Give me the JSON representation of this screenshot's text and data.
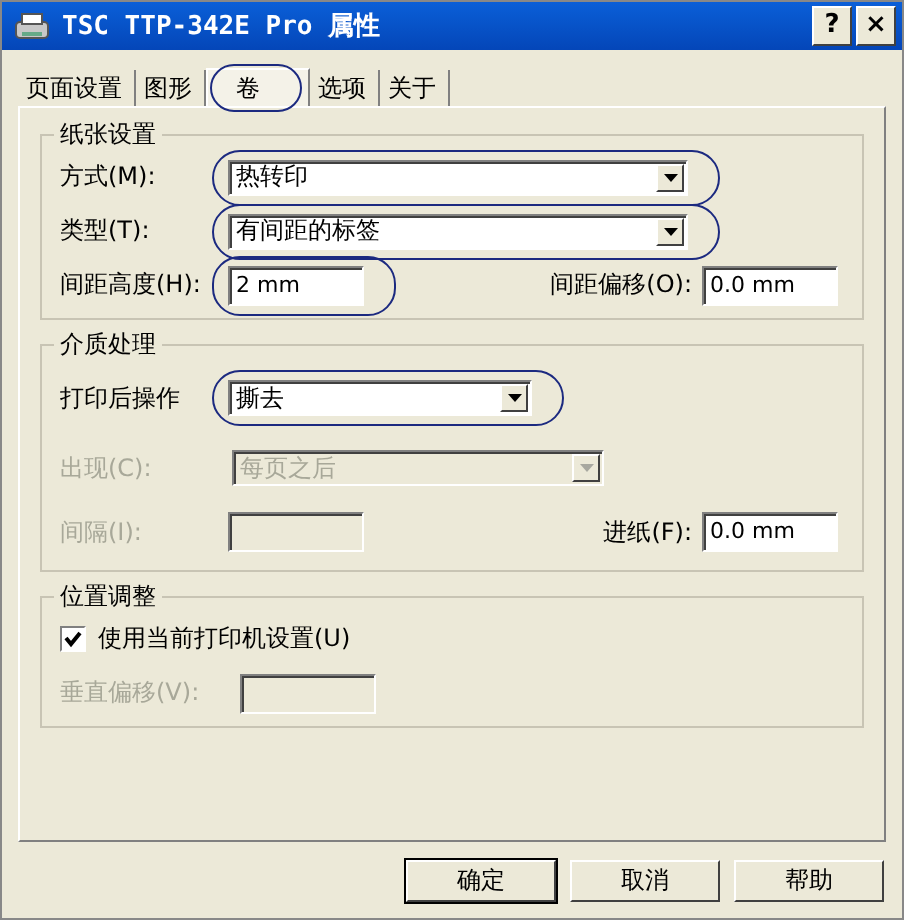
{
  "window": {
    "title": "TSC TTP-342E Pro 属性",
    "title_buttons": [
      "?",
      "×"
    ]
  },
  "tabs": [
    {
      "label": "页面设置",
      "selected": false,
      "highlighted": false
    },
    {
      "label": "图形",
      "selected": false,
      "highlighted": false
    },
    {
      "label": "卷",
      "selected": true,
      "highlighted": true
    },
    {
      "label": "选项",
      "selected": false,
      "highlighted": false
    },
    {
      "label": "关于",
      "selected": false,
      "highlighted": false
    }
  ],
  "groups": [
    {
      "title": "纸张设置",
      "rows": [
        [
          {
            "kind": "combo",
            "label": "方式(M):",
            "value": "热转印",
            "disabled": false,
            "highlighted": true
          }
        ],
        [
          {
            "kind": "combo",
            "label": "类型(T):",
            "value": "有间距的标签",
            "disabled": false,
            "highlighted": true
          }
        ],
        [
          {
            "kind": "input",
            "label": "间距高度(H):",
            "value": "2 mm",
            "disabled": false,
            "highlighted": true
          },
          {
            "kind": "input",
            "label": "间距偏移(O):",
            "value": "0.0 mm",
            "disabled": false,
            "highlighted": false
          }
        ]
      ]
    },
    {
      "title": "介质处理",
      "rows": [
        [
          {
            "kind": "combo",
            "label": "打印后操作",
            "value": "撕去",
            "disabled": false,
            "highlighted": true
          }
        ],
        [
          {
            "kind": "combo",
            "label": "出现(C):",
            "value": "每页之后",
            "disabled": true,
            "highlighted": false
          }
        ],
        [
          {
            "kind": "input",
            "label": "间隔(I):",
            "disabled": true,
            "highlighted": false
          },
          {
            "kind": "input",
            "label": "进纸(F):",
            "value": "0.0 mm",
            "disabled": false,
            "highlighted": false
          }
        ]
      ]
    },
    {
      "title": "位置调整",
      "rows": [
        [
          {
            "kind": "checkbox",
            "label": "使用当前打印机设置(U)",
            "checked": true
          }
        ],
        [
          {
            "kind": "input",
            "label": "垂直偏移(V):",
            "disabled": true,
            "highlighted": false
          }
        ]
      ]
    }
  ],
  "buttons": [
    {
      "label": "确定",
      "default": true
    },
    {
      "label": "取消",
      "default": false
    },
    {
      "label": "帮助",
      "default": false
    }
  ]
}
